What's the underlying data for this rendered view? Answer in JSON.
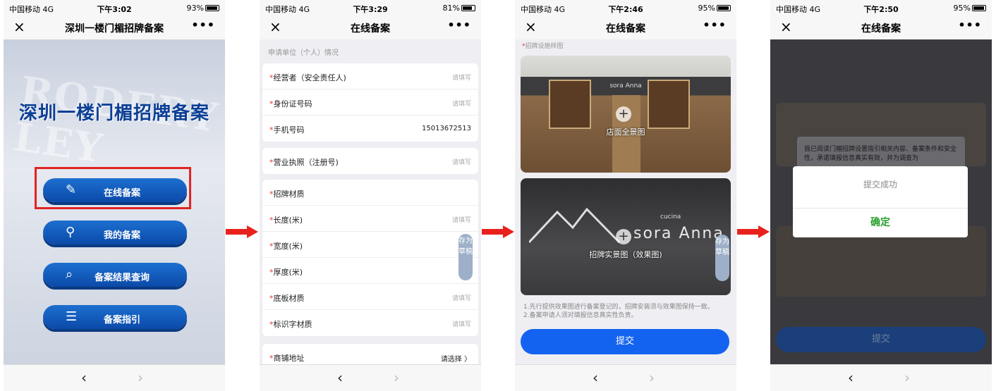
{
  "status_bars": [
    {
      "carrier": "中国移动 4G",
      "time": "下午3:02",
      "battery": "93%",
      "level": 0.93
    },
    {
      "carrier": "中国移动 4G",
      "time": "下午3:29",
      "battery": "81%",
      "level": 0.81
    },
    {
      "carrier": "中国移动 4G",
      "time": "下午2:46",
      "battery": "95%",
      "level": 0.95
    },
    {
      "carrier": "中国移动 4G",
      "time": "下午2:50",
      "battery": "95%",
      "level": 0.95
    }
  ],
  "nav_titles": [
    "深圳一楼门楣招牌备案",
    "在线备案",
    "在线备案",
    "在线备案"
  ],
  "nav_icons": {
    "close": "×",
    "more": "•••",
    "back": "‹",
    "forward": "›"
  },
  "screen1": {
    "heading": "深圳一楼门楣招牌备案",
    "bg_watermark": "RODERY LEY",
    "menu": [
      {
        "label": "在线备案",
        "icon": "✎"
      },
      {
        "label": "我的备案",
        "icon": "⚲"
      },
      {
        "label": "备案结果查询",
        "icon": "⌕"
      },
      {
        "label": "备案指引",
        "icon": "☰"
      }
    ]
  },
  "screen2": {
    "section_title": "申请单位（个人）情况",
    "groups": [
      [
        {
          "label": "经营者（安全责任人)",
          "value": "请填写"
        },
        {
          "label": "身份证号码",
          "value": "请填写"
        },
        {
          "label": "手机号码",
          "value": "15013672513"
        }
      ],
      [
        {
          "label": "营业执照（注册号)",
          "value": "请填写"
        }
      ],
      [
        {
          "label": "招牌材质",
          "value": ""
        },
        {
          "label": "长度(米)",
          "value": "请填写"
        },
        {
          "label": "宽度(米)",
          "value": ""
        },
        {
          "label": "厚度(米)",
          "value": ""
        },
        {
          "label": "底板材质",
          "value": "请填写"
        },
        {
          "label": "标识字材质",
          "value": "请填写"
        }
      ],
      [
        {
          "label": "商铺地址",
          "value": "请选择 〉"
        }
      ]
    ],
    "draft_button": "存为草稿"
  },
  "screen3": {
    "section_title": "招牌设施样图",
    "photo1_label": "店面全景图",
    "photo1_sign": "sora Anna",
    "photo2_label": "招牌实景图（效果图)",
    "photo2_sign_small": "cucina",
    "photo2_sign": "sora Anna",
    "draft_button": "存为草稿",
    "notes": [
      "1.先行提供效果图进行备案登记的，招牌安装须与效果图保持一致。",
      "2.备案申请人须对填报信息真实性负责。"
    ],
    "submit": "提交"
  },
  "screen4": {
    "dialog_message": "提交成功",
    "dialog_confirm": "确定",
    "background_text": "我已阅读门楣招牌设置指引相关内容、备案条件和安全性，承诺填报信息真实有效，并为调查为",
    "background_submit": "提交"
  },
  "colors": {
    "accent": "#1463f0",
    "required": "#e23a2e",
    "confirm": "#27a02a",
    "highlight": "#e12323",
    "arrow": "#e8211c"
  }
}
